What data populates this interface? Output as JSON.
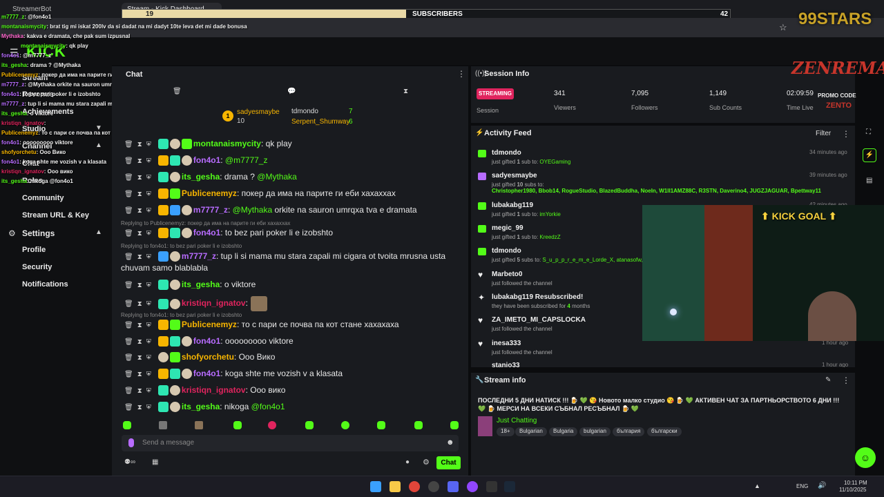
{
  "browser": {
    "tabs": [
      {
        "label": "StreamerBot"
      },
      {
        "label": "Stream - Kick Dashboard"
      }
    ]
  },
  "overlay_bar": {
    "left_count": "19",
    "label": "SUBSCRIBERS",
    "right_count": "42"
  },
  "logo": {
    "text": "KICK"
  },
  "stars_logo": "99STARS",
  "zenrema": {
    "title": "ZENREMA!",
    "promo": "PROMO CODE",
    "code": "ZENTO"
  },
  "kick_goal": "KICK GOAL",
  "sidebar": {
    "items": [
      {
        "label": "Stream"
      },
      {
        "label": "Revenue"
      },
      {
        "label": "Achievements"
      },
      {
        "label": "Studio"
      },
      {
        "label": "Channel"
      },
      {
        "label": "Chat"
      },
      {
        "label": "Roles"
      },
      {
        "label": "Community"
      },
      {
        "label": "Stream URL & Key"
      }
    ],
    "settings_label": "Settings",
    "settings_items": [
      {
        "label": "Profile"
      },
      {
        "label": "Security"
      },
      {
        "label": "Notifications"
      }
    ]
  },
  "overlay_chat": [
    {
      "user": "m7777_z",
      "text": ": @fon4o1"
    },
    {
      "user": "montanaismycity",
      "text": ": brat tig mi iskat 200lv da si dadat na mi dadyt 10te leva det mi dade bonusa"
    },
    {
      "user": "Mythaka",
      "text": ": kakva e dramata, che pak sum izpusnal"
    },
    {
      "user": "montanaismycity",
      "text": ": qk play"
    },
    {
      "user": "fon4o1",
      "text": ": @m7777_z"
    },
    {
      "user": "its_gesha",
      "text": ": drama ? @Mythaka"
    },
    {
      "user": "Publicenemyz",
      "text": ": покер да има на парите ги еби хахаххах"
    },
    {
      "user": "m7777_z",
      "text": ": @Mythaka orkite na sauron umrqxa tva e dramata"
    },
    {
      "user": "fon4o1",
      "text": ": to bez pari poker li e izobshto"
    },
    {
      "user": "m7777_z",
      "text": ": tup li si mama mu stara zapali mi cigara ot tvoita mrusna usta chuvam samo blablabla"
    },
    {
      "user": "its_gesha",
      "text": ": o viktore"
    },
    {
      "user": "kristiqn_ignatov",
      "text": ":"
    },
    {
      "user": "Publicenemyz",
      "text": ": то с пари се почва па кот стане хахахаха"
    },
    {
      "user": "fon4o1",
      "text": ": ooooooooo viktore"
    },
    {
      "user": "shofyorchetu",
      "text": ": Ооо Вико"
    },
    {
      "user": "fon4o1",
      "text": ": koga shte me vozish v a klasata"
    },
    {
      "user": "kristiqn_ignatov",
      "text": ": Ооо вико"
    },
    {
      "user": "its_gesha",
      "text": ": nikoga @fon4o1"
    }
  ],
  "chat": {
    "title": "Chat",
    "pinned": [
      {
        "user": "sadyesmaybe",
        "count": "10",
        "rank": "1"
      },
      {
        "user": "tdmondo",
        "count": "7"
      },
      {
        "user": "Serpent_Shumway",
        "count": "6"
      }
    ],
    "messages": [
      {
        "user": "montanaismycity",
        "text": ": qk play",
        "color": "#53fc18"
      },
      {
        "user": "fon4o1",
        "text": ": ",
        "mention": "@m7777_z",
        "color": "#b86cff"
      },
      {
        "user": "its_gesha",
        "text": ": drama ? ",
        "mention": "@Mythaka",
        "color": "#53fc18"
      },
      {
        "user": "Publicenemyz",
        "text": ": покер да има на парите ги еби хахаххах",
        "color": "#f7b500"
      },
      {
        "user": "m7777_z",
        "text": ": ",
        "mention": "@Mythaka",
        "text2": " orkite na sauron umrqxa tva e dramata",
        "color": "#b86cff"
      },
      {
        "reply": "Replying to Publicenemyz: покер да има на парите ги еби хахаххах",
        "user": "fon4o1",
        "text": ": to bez pari poker li e izobshto",
        "color": "#b86cff"
      },
      {
        "reply": "Replying to fon4o1: to bez pari poker li e izobshto",
        "user": "m7777_z",
        "text": ": tup li si mama mu stara zapali mi cigara ot tvoita mrusna usta",
        "text_cont": "chuvam samo blablabla",
        "color": "#b86cff"
      },
      {
        "user": "its_gesha",
        "text": ": o viktore",
        "color": "#53fc18"
      },
      {
        "user": "kristiqn_ignatov",
        "text": ":",
        "color": "#e0245e"
      },
      {
        "reply": "Replying to fon4o1: to bez pari poker li e izobshto",
        "user": "Publicenemyz",
        "text": ": то с пари се почва па кот стане хахахаха",
        "color": "#f7b500"
      },
      {
        "user": "fon4o1",
        "text": ": ооооооооо viktore",
        "color": "#b86cff"
      },
      {
        "user": "shofyorchetu",
        "text": ": Ооо Вико",
        "color": "#f7b500"
      },
      {
        "user": "fon4o1",
        "text": ": koga shte me vozish v a klasata",
        "color": "#b86cff"
      },
      {
        "user": "kristiqn_ignatov",
        "text": ": Ооо вико",
        "color": "#e0245e"
      },
      {
        "user": "its_gesha",
        "text": ": nikoga ",
        "mention": "@fon4o1",
        "color": "#53fc18"
      }
    ],
    "input_placeholder": "Send a message",
    "send_label": "Chat"
  },
  "session": {
    "title": "Session Info",
    "status": "STREAMING",
    "status_caption": "Session",
    "stats": [
      {
        "value": "341",
        "label": "Viewers"
      },
      {
        "value": "7,095",
        "label": "Followers"
      },
      {
        "value": "1,149",
        "label": "Sub Counts"
      },
      {
        "value": "02:09:59",
        "label": "Time Live"
      }
    ]
  },
  "activity": {
    "title": "Activity Feed",
    "filter_label": "Filter",
    "items": [
      {
        "name": "tdmondo",
        "pre": "just gifted ",
        "count": "1",
        "mid": " sub to: ",
        "target": "OYEGaming",
        "time": "34 minutes ago"
      },
      {
        "name": "sadyesmaybe",
        "pre": "just gifted ",
        "count": "10",
        "mid": " subs to:",
        "target": "Christopher1980, Bbob14, RogueStudio, BlazedBuddha, NoeIn, W1II1AMZ88C, R3STN, Daverino4, JUGZJAGUAR, Bpettway11",
        "time": "39 minutes ago"
      },
      {
        "name": "lubakabg119",
        "pre": "just gifted ",
        "count": "1",
        "mid": " sub to: ",
        "target": "imYorkie",
        "time": "42 minutes ago"
      },
      {
        "name": "megic_99",
        "pre": "just gifted ",
        "count": "1",
        "mid": " sub to: ",
        "target": "KreedzZ",
        "time": ""
      },
      {
        "name": "tdmondo",
        "pre": "just gifted ",
        "count": "5",
        "mid": " subs to: ",
        "target": "S_u_p_p_r_e_m_e_Lorde_X, atanasofw,",
        "time": ""
      },
      {
        "name": "Marbeto0",
        "pre": "just followed the channel",
        "time": ""
      },
      {
        "name": "lubakabg119 Resubscribed!",
        "pre": "they have been subscribed for ",
        "count": "4",
        "mid": " months",
        "time": ""
      },
      {
        "name": "ZA_IMETO_MI_CAPSLOCKA",
        "pre": "just followed the channel",
        "time": ""
      },
      {
        "name": "inesa333",
        "pre": "just followed the channel",
        "time": "1 hour ago"
      },
      {
        "name": "stanio33",
        "pre": "",
        "time": "1 hour ago"
      }
    ]
  },
  "stream_info": {
    "title": "Stream info",
    "description": "ПОСЛЕДНИ 5 ДНИ НАТИСК !!! 🍺 💚 😘 Новото малко студио 😘 🍺 💚 АКТИВЕН ЧАТ ЗА ПАРТНЬОРСТВОТО 6 ДНИ !!! 💚 🍺 МЕРСИ НА ВСЕКИ СЪБНАЛ РЕСЪБНАЛ 🍺 💚",
    "category": "Just Chatting",
    "tags": [
      "18+",
      "Bulgarian",
      "Bulgaria",
      "bulgarian",
      "българия",
      "български"
    ]
  },
  "taskbar": {
    "lang": "ENG",
    "time": "10:11 PM",
    "date": "11/10/2025"
  }
}
